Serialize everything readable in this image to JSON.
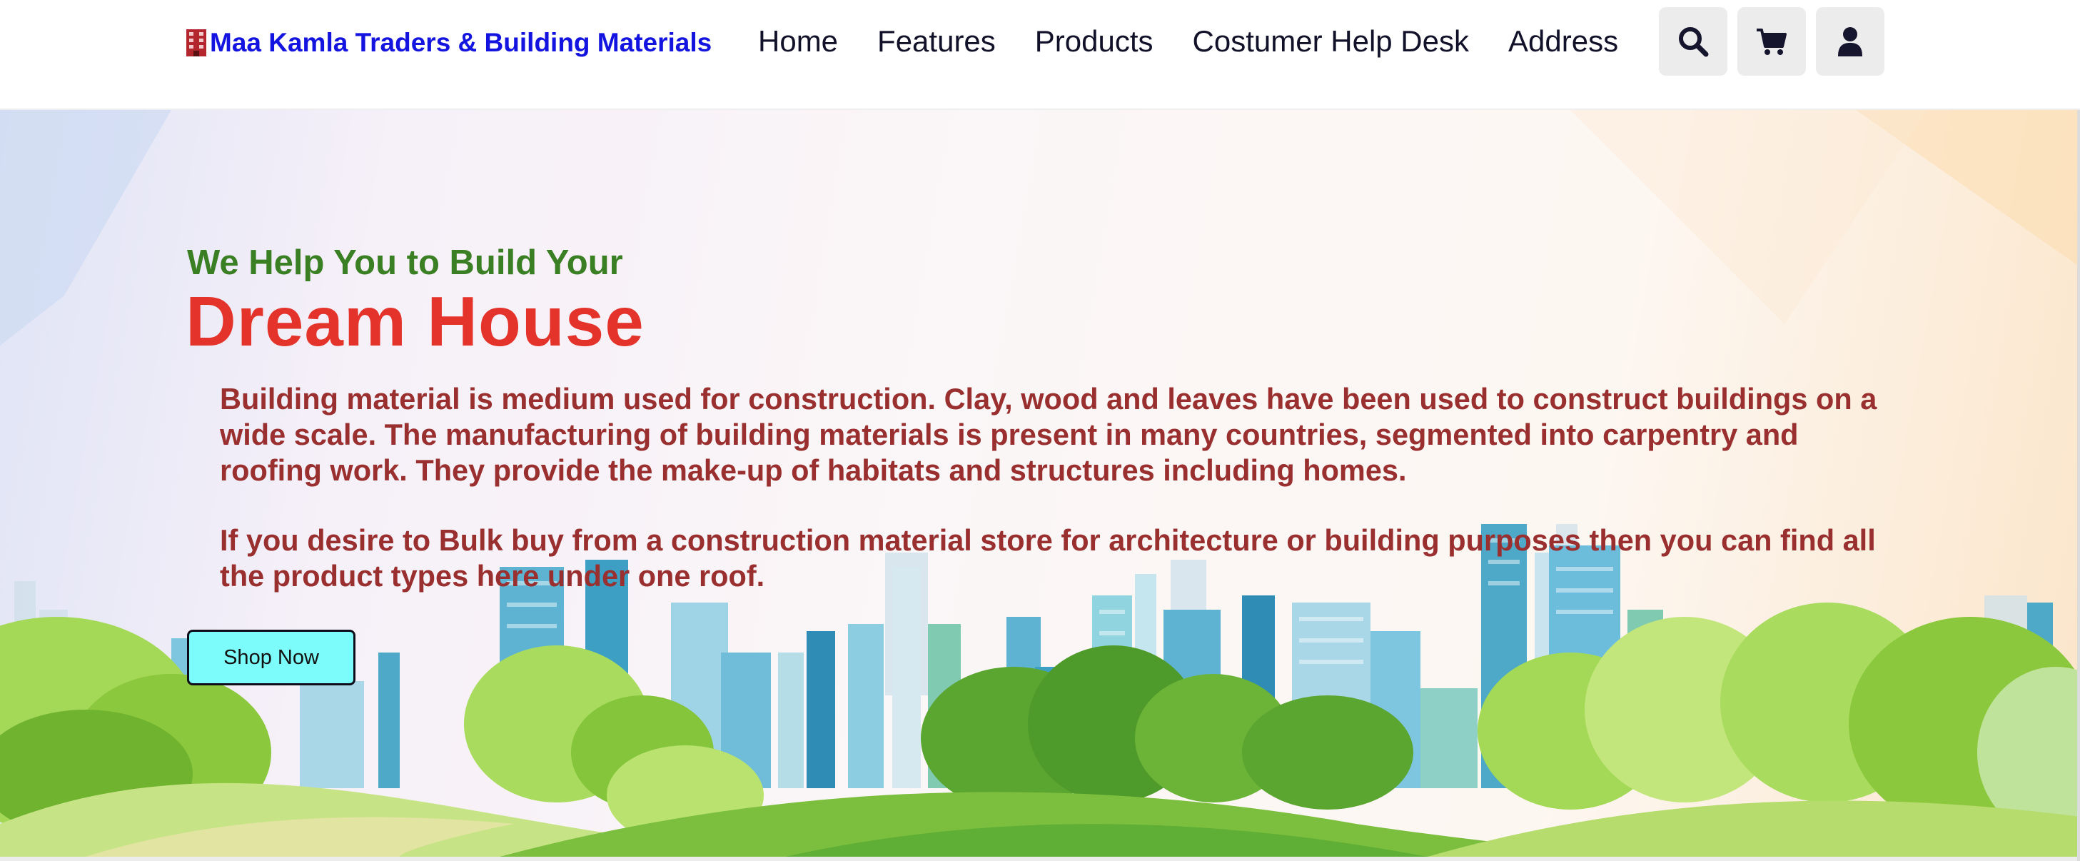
{
  "header": {
    "brand": "Maa Kamla Traders & Building Materials",
    "brand_icon": "building-icon",
    "nav": [
      {
        "label": "Home"
      },
      {
        "label": "Features"
      },
      {
        "label": "Products"
      },
      {
        "label": "Costumer Help Desk"
      },
      {
        "label": "Address"
      }
    ],
    "icons": [
      "search-icon",
      "cart-icon",
      "user-icon"
    ]
  },
  "hero": {
    "subtitle": "We Help You to Build Your",
    "title": "Dream House",
    "paragraph_1": "Building material is medium used for construction. Clay, wood and leaves have been used to construct buildings on a wide scale. The manufacturing of building materials is present in many countries, segmented into carpentry and roofing work. They provide the make-up of habitats and structures including homes.",
    "paragraph_2": "If you desire to Bulk buy from a construction material store for architecture or building purposes then you can find all the product types here under one roof.",
    "cta_label": "Shop Now"
  },
  "colors": {
    "brand": "#1414e0",
    "subtitle": "#3a7f24",
    "title": "#e4332b",
    "paragraph": "#9a2f2f",
    "cta_bg": "#7cfdfb",
    "icon_btn_bg": "#ececec"
  }
}
